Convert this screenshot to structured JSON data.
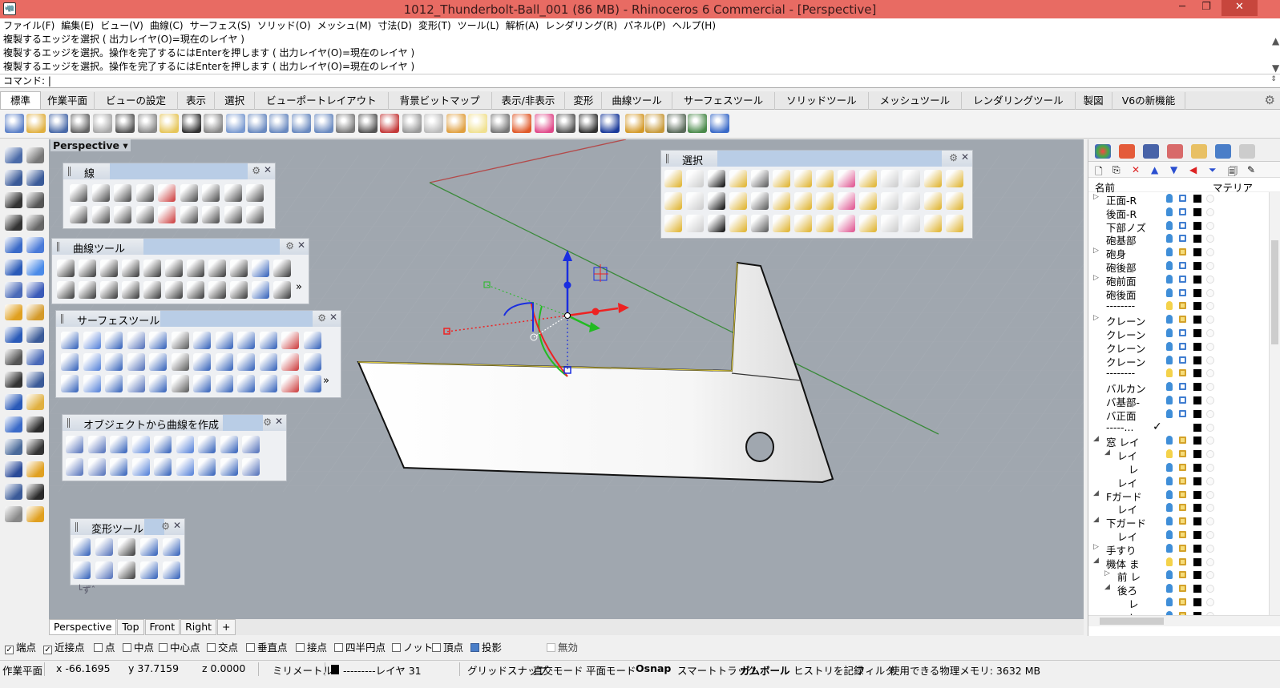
{
  "window": {
    "title": "1012_Thunderbolt-Ball_001 (86 MB) - Rhinoceros 6 Commercial - [Perspective]",
    "minimize": "─",
    "restore": "❐",
    "close": "✕"
  },
  "menu": [
    "ファイル(F)",
    "編集(E)",
    "ビュー(V)",
    "曲線(C)",
    "サーフェス(S)",
    "ソリッド(O)",
    "メッシュ(M)",
    "寸法(D)",
    "変形(T)",
    "ツール(L)",
    "解析(A)",
    "レンダリング(R)",
    "パネル(P)",
    "ヘルプ(H)"
  ],
  "command_history": [
    "複製するエッジを選択 ( 出力レイヤ(O)=現在のレイヤ )",
    "複製するエッジを選択。操作を完了するにはEnterを押します ( 出力レイヤ(O)=現在のレイヤ )",
    "複製するエッジを選択。操作を完了するにはEnterを押します ( 出力レイヤ(O)=現在のレイヤ )"
  ],
  "command_prompt": "コマンド: |",
  "tabs": [
    "標準",
    "作業平面",
    "ビューの設定",
    "表示",
    "選択",
    "ビューポートレイアウト",
    "背景ビットマップ",
    "表示/非表示",
    "変形",
    "曲線ツール",
    "サーフェスツール",
    "ソリッドツール",
    "メッシュツール",
    "レンダリングツール",
    "製図",
    "V6の新機能"
  ],
  "toolbar_icons": [
    "new-icon",
    "open-icon",
    "save-icon",
    "print-icon",
    "import-icon",
    "cut-icon",
    "copy-icon",
    "paste-icon",
    "undo-icon",
    "pan-icon",
    "move-icon",
    "zoom-icon",
    "zoom-window-icon",
    "zoom-extents-icon",
    "zoom-selected-icon",
    "rotate-view-icon",
    "viewport-layout-icon",
    "car-icon",
    "display-mode-icon",
    "snap-icon",
    "cplane-icon",
    "light-icon",
    "lock-icon",
    "layer-icon",
    "color-icon",
    "render-sphere-icon",
    "render-sphere2-icon",
    "material-sphere-icon",
    "pen-icon",
    "settings-gear-icon",
    "grid-icon",
    "globe-icon",
    "help-icon"
  ],
  "viewport": {
    "label": "Perspective",
    "tabs": [
      "Perspective",
      "Top",
      "Front",
      "Right",
      "+"
    ]
  },
  "panels": {
    "line": {
      "title": "線"
    },
    "curve_tools": {
      "title": "曲線ツール"
    },
    "surface_tools": {
      "title": "サーフェスツール"
    },
    "curve_from_object": {
      "title": "オブジェクトから曲線を作成"
    },
    "transform_tools": {
      "title": "変形ツール",
      "footer": "└ずˆ"
    },
    "select": {
      "title": "選択"
    },
    "more": "»"
  },
  "osnap": [
    {
      "label": "端点",
      "checked": true
    },
    {
      "label": "近接点",
      "checked": true
    },
    {
      "label": "点",
      "checked": false
    },
    {
      "label": "中点",
      "checked": false
    },
    {
      "label": "中心点",
      "checked": false
    },
    {
      "label": "交点",
      "checked": false
    },
    {
      "label": "垂直点",
      "checked": false
    },
    {
      "label": "接点",
      "checked": false
    },
    {
      "label": "四半円点",
      "checked": false
    },
    {
      "label": "ノット",
      "checked": false
    },
    {
      "label": "頂点",
      "checked": false
    },
    {
      "label": "投影",
      "checked": true
    },
    {
      "label": "無効",
      "checked": false
    }
  ],
  "status": {
    "cplane": "作業平面",
    "x": "x -66.1695",
    "y": "y 37.7159",
    "z": "z 0.0000",
    "units": "ミリメートル",
    "layer": "---------レイヤ 31",
    "grid_snap": "グリッドスナップ",
    "ortho": "直交モード",
    "planar": "平面モード",
    "osnap": "Osnap",
    "smarttrack": "スマートトラック",
    "gumball": "ガムボール",
    "history": "ヒストリを記録",
    "filter": "フィルタ",
    "memory": "使用できる物理メモリ: 3632 MB"
  },
  "layers": {
    "col_name": "名前",
    "col_material": "マテリア",
    "rows": [
      {
        "name": "正面-R",
        "indent": 1,
        "expander": "▷",
        "bulb": "on",
        "lock": "closed"
      },
      {
        "name": "後面-R",
        "indent": 1,
        "expander": "",
        "bulb": "on",
        "lock": "closed"
      },
      {
        "name": "下部ノズ",
        "indent": 1,
        "expander": "",
        "bulb": "on",
        "lock": "closed"
      },
      {
        "name": "砲基部",
        "indent": 1,
        "expander": "",
        "bulb": "on",
        "lock": "closed"
      },
      {
        "name": "砲身",
        "indent": 1,
        "expander": "▷",
        "bulb": "on",
        "lock": "open"
      },
      {
        "name": "砲後部",
        "indent": 1,
        "expander": "",
        "bulb": "on",
        "lock": "closed"
      },
      {
        "name": "砲前面",
        "indent": 1,
        "expander": "▷",
        "bulb": "on",
        "lock": "closed"
      },
      {
        "name": "砲後面",
        "indent": 1,
        "expander": "",
        "bulb": "on",
        "lock": "closed"
      },
      {
        "name": "--------",
        "indent": 1,
        "expander": "",
        "bulb": "dim",
        "lock": "open"
      },
      {
        "name": "クレーン",
        "indent": 1,
        "expander": "▷",
        "bulb": "on",
        "lock": "open"
      },
      {
        "name": "クレーン",
        "indent": 1,
        "expander": "",
        "bulb": "on",
        "lock": "closed"
      },
      {
        "name": "クレーン",
        "indent": 1,
        "expander": "",
        "bulb": "on",
        "lock": "closed"
      },
      {
        "name": "クレーン",
        "indent": 1,
        "expander": "",
        "bulb": "on",
        "lock": "closed"
      },
      {
        "name": "--------",
        "indent": 1,
        "expander": "",
        "bulb": "dim",
        "lock": "open"
      },
      {
        "name": "バルカン",
        "indent": 1,
        "expander": "",
        "bulb": "on",
        "lock": "closed"
      },
      {
        "name": "バ基部-",
        "indent": 1,
        "expander": "",
        "bulb": "on",
        "lock": "closed"
      },
      {
        "name": "バ正面",
        "indent": 1,
        "expander": "",
        "bulb": "on",
        "lock": "closed"
      },
      {
        "name": "-----...",
        "indent": 1,
        "expander": "",
        "bulb": "none",
        "lock": "none",
        "current": true
      },
      {
        "name": "窓 レイ",
        "indent": 1,
        "expander": "◢",
        "bulb": "on",
        "lock": "open"
      },
      {
        "name": "レイ",
        "indent": 2,
        "expander": "◢",
        "bulb": "dim",
        "lock": "open"
      },
      {
        "name": "レ",
        "indent": 3,
        "expander": "",
        "bulb": "on",
        "lock": "open"
      },
      {
        "name": "レイ",
        "indent": 2,
        "expander": "",
        "bulb": "on",
        "lock": "open"
      },
      {
        "name": "Fガード",
        "indent": 1,
        "expander": "◢",
        "bulb": "on",
        "lock": "open"
      },
      {
        "name": "レイ",
        "indent": 2,
        "expander": "",
        "bulb": "on",
        "lock": "open"
      },
      {
        "name": "下ガード",
        "indent": 1,
        "expander": "◢",
        "bulb": "on",
        "lock": "open"
      },
      {
        "name": "レイ",
        "indent": 2,
        "expander": "",
        "bulb": "on",
        "lock": "open"
      },
      {
        "name": "手すり",
        "indent": 1,
        "expander": "▷",
        "bulb": "on",
        "lock": "open"
      },
      {
        "name": "機体 ま",
        "indent": 1,
        "expander": "◢",
        "bulb": "dim",
        "lock": "open"
      },
      {
        "name": "前 レ",
        "indent": 2,
        "expander": "▷",
        "bulb": "on",
        "lock": "open"
      },
      {
        "name": "後ろ",
        "indent": 2,
        "expander": "◢",
        "bulb": "on",
        "lock": "open"
      },
      {
        "name": "レ",
        "indent": 3,
        "expander": "",
        "bulb": "on",
        "lock": "open"
      },
      {
        "name": "レ",
        "indent": 3,
        "expander": "",
        "bulb": "on",
        "lock": "open"
      }
    ],
    "current_mark": "✓"
  }
}
